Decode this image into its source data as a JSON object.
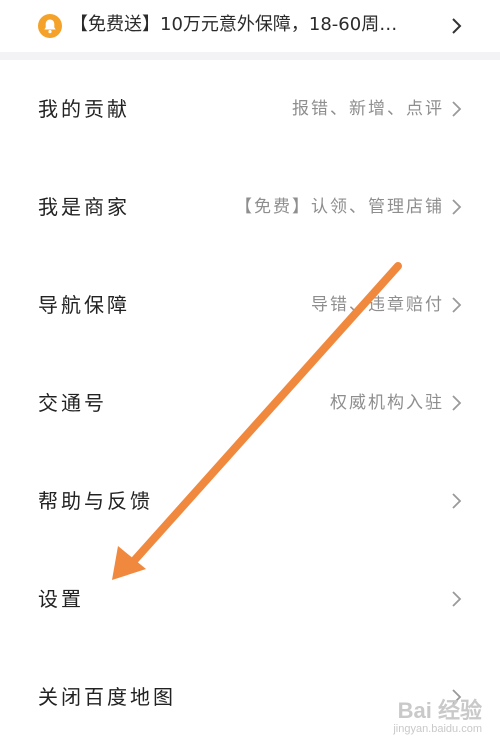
{
  "promo": {
    "text": "【免费送】10万元意外保障，18-60周…",
    "icon": "bell-icon",
    "accent": "#f4a22a"
  },
  "menu": {
    "items": [
      {
        "label": "我的贡献",
        "hint": "报错、新增、点评"
      },
      {
        "label": "我是商家",
        "hint": "【免费】认领、管理店铺"
      },
      {
        "label": "导航保障",
        "hint": "导错、违章赔付"
      },
      {
        "label": "交通号",
        "hint": "权威机构入驻"
      },
      {
        "label": "帮助与反馈",
        "hint": ""
      },
      {
        "label": "设置",
        "hint": ""
      },
      {
        "label": "关闭百度地图",
        "hint": ""
      }
    ]
  },
  "annotation": {
    "arrow_color": "#f0883e"
  },
  "watermark": {
    "main": "Bai 经验",
    "sub": "jingyan.baidu.com"
  }
}
